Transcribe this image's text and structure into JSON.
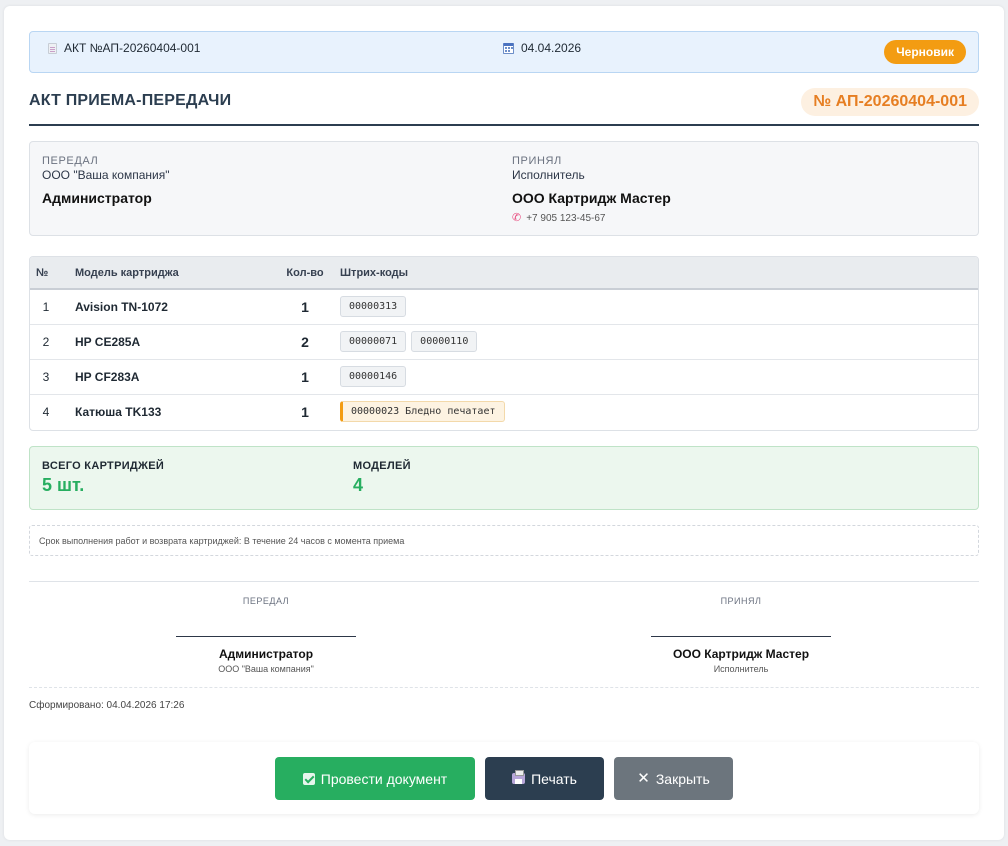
{
  "topbar": {
    "doc_label": "АКТ №АП-20260404-001",
    "doc_icon": "document-icon",
    "date": "04.04.2026",
    "date_icon": "calendar-icon",
    "status": "Черновик",
    "status_color": "#f39c12"
  },
  "header": {
    "title": "АКТ ПРИЕМА-ПЕРЕДАЧИ",
    "number": "№ АП-20260404-001"
  },
  "parties": {
    "sender": {
      "role": "ПЕРЕДАЛ",
      "subtitle": "ООО \"Ваша компания\"",
      "name": "Администратор"
    },
    "receiver": {
      "role": "ПРИНЯЛ",
      "subtitle": "Исполнитель",
      "name": "ООО Картридж Мастер",
      "phone": "+7 905 123-45-67",
      "phone_icon": "phone-icon"
    }
  },
  "table": {
    "headers": {
      "num": "№",
      "model": "Модель картриджа",
      "qty": "Кол-во",
      "codes": "Штрих-коды"
    },
    "rows": [
      {
        "num": "1",
        "model": "Avision TN-1072",
        "qty": "1",
        "codes": [
          {
            "text": "00000313"
          }
        ]
      },
      {
        "num": "2",
        "model": "HP CE285A",
        "qty": "2",
        "codes": [
          {
            "text": "00000071"
          },
          {
            "text": "00000110"
          }
        ]
      },
      {
        "num": "3",
        "model": "HP CF283A",
        "qty": "1",
        "codes": [
          {
            "text": "00000146"
          }
        ]
      },
      {
        "num": "4",
        "model": "Катюша TK133",
        "qty": "1",
        "codes": [
          {
            "text": "00000023 Бледно печатает"
          }
        ]
      }
    ]
  },
  "summary": {
    "total_label": "ВСЕГО КАРТРИДЖЕЙ",
    "total_value": "5 шт.",
    "models_label": "МОДЕЛЕЙ",
    "models_value": "4",
    "accent_color": "#27ae60"
  },
  "terms": "Срок выполнения работ и возврата картриджей: В течение 24 часов с момента приема",
  "signatures": {
    "sender": {
      "role": "ПЕРЕДАЛ",
      "name": "Администратор",
      "subtitle": "ООО \"Ваша компания\""
    },
    "receiver": {
      "role": "ПРИНЯЛ",
      "name": "ООО Картридж Мастер",
      "subtitle": "Исполнитель"
    }
  },
  "generated": "Сформировано: 04.04.2026 17:26",
  "actions": {
    "post_label": "Провести документ",
    "post_icon": "check-icon",
    "print_label": "Печать",
    "print_icon": "printer-icon",
    "close_label": "Закрыть",
    "close_icon": "close-icon",
    "post_color": "#27ae60",
    "print_color": "#2c3e50",
    "close_color": "#6c757d"
  }
}
